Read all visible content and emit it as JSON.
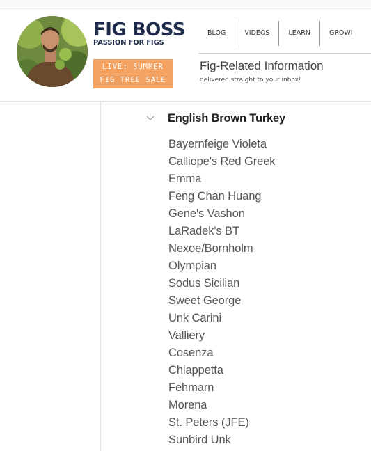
{
  "site": {
    "logo_title": "FIG BOSS",
    "logo_subtitle": "PASSION FOR FIGS"
  },
  "nav": [
    "BLOG",
    "VIDEOS",
    "LEARN",
    "GROWI"
  ],
  "promo": {
    "line1": "LIVE: SUMMER",
    "line2": "FIG TREE SALE",
    "color": "#f4a261"
  },
  "newsletter": {
    "title": "Fig-Related Information",
    "subtitle": "delivered straight to your inbox!"
  },
  "variety_group": {
    "title": "English Brown Turkey",
    "expanded": true,
    "items": [
      "Bayernfeige Violeta",
      "Calliope's Red Greek",
      "Emma",
      "Feng Chan Huang",
      "Gene's Vashon",
      "LaRadek's BT",
      "Nexoe/Bornholm",
      "Olympian",
      "Sodus Sicilian",
      "Sweet George",
      "Unk Carini",
      "Valliery",
      "Cosenza",
      "Chiappetta",
      "Fehmarn",
      "Morena",
      "St. Peters (JFE)",
      "Sunbird Unk"
    ]
  }
}
